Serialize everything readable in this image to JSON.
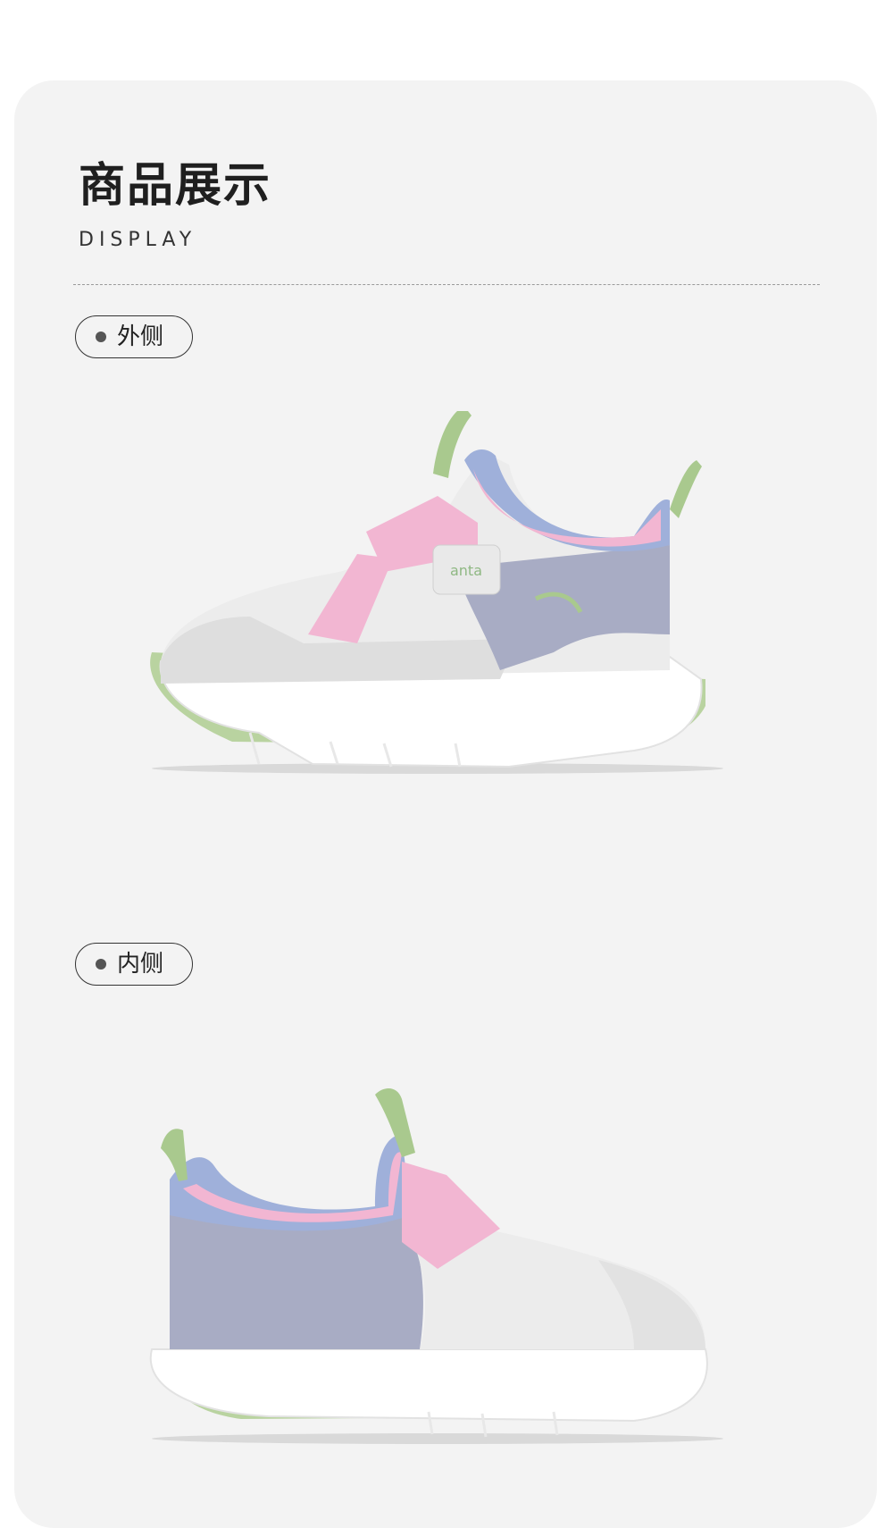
{
  "section": {
    "title": "商品展示",
    "subtitle": "DISPLAY"
  },
  "views": [
    {
      "label": "外侧",
      "image": "shoe-outer-side"
    },
    {
      "label": "内侧",
      "image": "shoe-inner-side"
    }
  ],
  "brand_logo": {
    "icon": "anta-logo",
    "text": "anta"
  },
  "colors": {
    "card_bg": "#f3f3f3",
    "mesh": "#ececec",
    "pink": "#f2b6d2",
    "lavender": "#9fb0da",
    "grey_panel": "#a8acc4",
    "green": "#a9c98e",
    "sole": "#ffffff"
  }
}
